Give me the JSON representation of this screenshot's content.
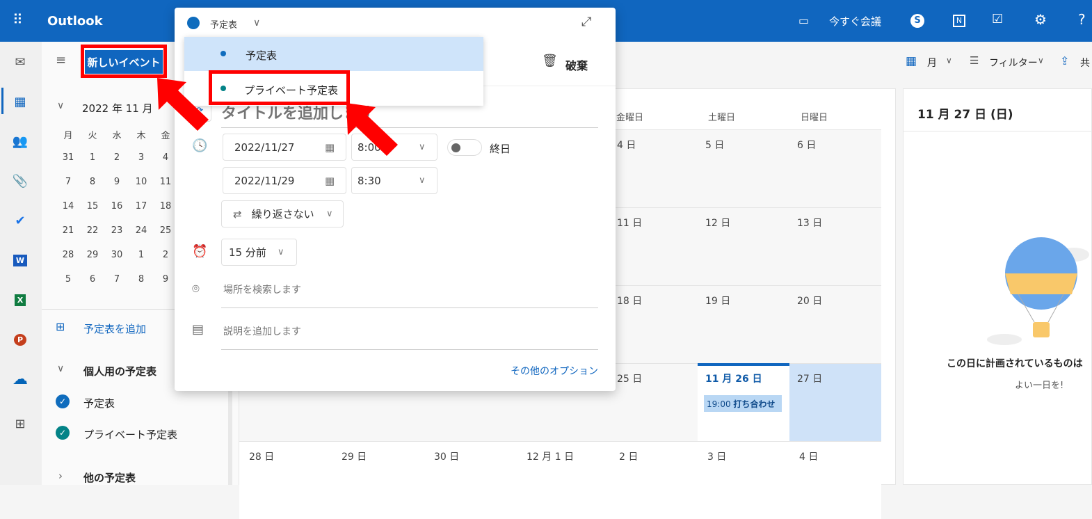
{
  "app": {
    "title": "Outlook",
    "accent": "#1066bf"
  },
  "topbar": {
    "meet_now": "今すぐ会議",
    "icons": [
      "waffle-icon",
      "video-icon",
      "skype-icon",
      "onenote-icon",
      "todo-icon",
      "gear-icon",
      "help-icon"
    ],
    "help": "?"
  },
  "rail": {
    "icons": [
      "mail-icon",
      "calendar-icon",
      "people-icon",
      "attach-icon",
      "todo-check-icon",
      "word-icon",
      "excel-icon",
      "powerpoint-icon",
      "onedrive-icon",
      "apps-icon"
    ]
  },
  "folder": {
    "new_event": "新しいイベント",
    "mini_title": "2022 年 11 月",
    "weekdays": [
      "月",
      "火",
      "水",
      "木",
      "金"
    ],
    "weeks": [
      [
        "31",
        "1",
        "2",
        "3",
        "4"
      ],
      [
        "7",
        "8",
        "9",
        "10",
        "11"
      ],
      [
        "14",
        "15",
        "16",
        "17",
        "18"
      ],
      [
        "21",
        "22",
        "23",
        "24",
        "25"
      ],
      [
        "28",
        "29",
        "30",
        "1",
        "2"
      ],
      [
        "5",
        "6",
        "7",
        "8",
        "9"
      ]
    ],
    "add_calendar": "予定表を追加",
    "personal_header": "個人用の予定表",
    "calendars": [
      {
        "label": "予定表",
        "color": "#0f6cbd"
      },
      {
        "label": "プライベート予定表",
        "color": "#038387"
      }
    ],
    "other_header": "他の予定表"
  },
  "toolbar": {
    "view": "月",
    "filter": "フィルター",
    "share": "共"
  },
  "grid": {
    "weekdays": [
      "金曜日",
      "土曜日",
      "日曜日"
    ],
    "rows": [
      [
        "4 日",
        "5 日",
        "6 日"
      ],
      [
        "11 日",
        "12 日",
        "13 日"
      ],
      [
        "18 日",
        "19 日",
        "20 日"
      ],
      [
        "25 日",
        "11 月 26 日",
        "27 日"
      ]
    ],
    "last_row": [
      "28 日",
      "29 日",
      "30 日",
      "12 月 1 日",
      "2 日",
      "3 日",
      "4 日"
    ],
    "event": {
      "time": "19:00",
      "title": "打ち合わせ"
    }
  },
  "right_pane": {
    "date": "11 月 27 日 (日)",
    "empty_title": "この日に計画されているものは",
    "empty_sub": "よい一日を!"
  },
  "dialog": {
    "calendar": "予定表",
    "discard": "破棄",
    "title_placeholder": "タイトルを追加します",
    "start_date": "2022/11/27",
    "start_time": "8:00",
    "end_date": "2022/11/29",
    "end_time": "8:30",
    "all_day": "終日",
    "all_day_on": false,
    "repeat": "繰り返さない",
    "reminder": "15 分前",
    "location_placeholder": "場所を検索します",
    "description_placeholder": "説明を追加します",
    "more_options": "その他のオプション",
    "dropdown": [
      {
        "label": "予定表",
        "color": "#0f6cbd",
        "selected": true
      },
      {
        "label": "プライベート予定表",
        "color": "#038387",
        "selected": false
      }
    ]
  },
  "annotation_color": "#ff0000"
}
